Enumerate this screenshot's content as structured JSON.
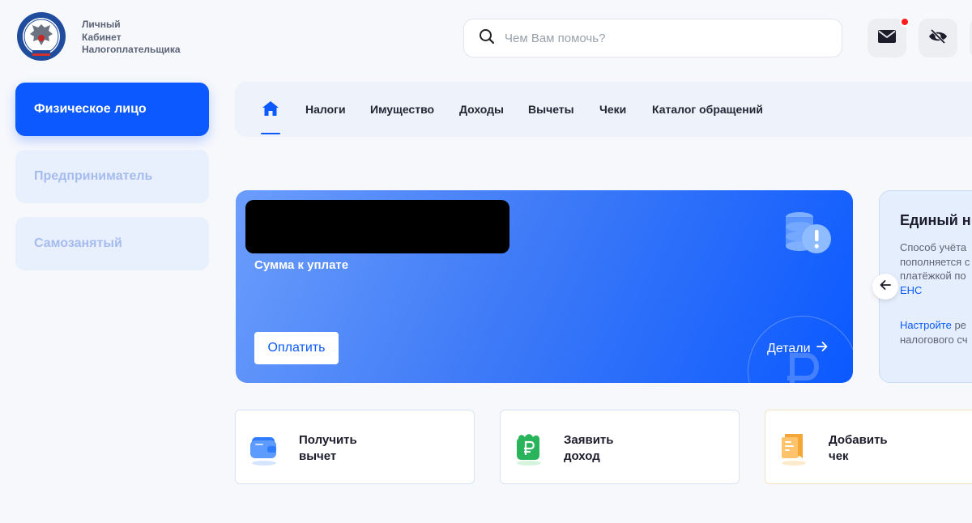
{
  "brand": {
    "lines": [
      "Личный",
      "Кабинет",
      "Налогоплательщика"
    ],
    "logo_icon": "fns-emblem-icon"
  },
  "search": {
    "placeholder": "Чем Вам помочь?"
  },
  "header_icons": {
    "mail": "mail-icon",
    "visibility": "eye-off-icon"
  },
  "colors": {
    "accent": "#0b59ff",
    "notification": "#ff1d1d"
  },
  "sidebar": {
    "items": [
      {
        "label": "Физическое лицо",
        "active": true
      },
      {
        "label": "Предприниматель",
        "active": false
      },
      {
        "label": "Самозанятый",
        "active": false
      }
    ]
  },
  "tabs": [
    "Налоги",
    "Имущество",
    "Доходы",
    "Вычеты",
    "Чеки",
    "Каталог обращений"
  ],
  "payment": {
    "label": "Сумма к уплате",
    "pay_button": "Оплатить",
    "details": "Детали"
  },
  "ens_card": {
    "title": "Единый н",
    "text_lines": [
      "Способ учёта",
      "пополняется с",
      "платёжкой по"
    ],
    "link": "ЕНС",
    "link2": "Настройте",
    "text2_rest": " ре",
    "text2_line2": "налогового сч"
  },
  "actions": [
    {
      "line1": "Получить",
      "line2": "вычет",
      "icon": "wallet-icon"
    },
    {
      "line1": "Заявить",
      "line2": "доход",
      "icon": "ruble-wallet-icon"
    },
    {
      "line1": "Добавить",
      "line2": "чек",
      "icon": "receipt-icon"
    }
  ]
}
